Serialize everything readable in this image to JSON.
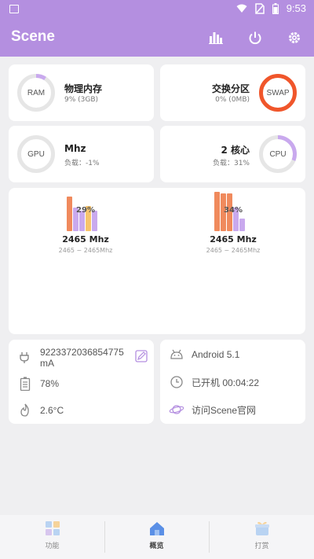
{
  "status": {
    "time": "9:53"
  },
  "app": {
    "title": "Scene"
  },
  "ram": {
    "ring_label": "RAM",
    "title": "物理内存",
    "sub": "9% (3GB)",
    "used_fraction": 0.09
  },
  "swap": {
    "ring_label": "SWAP",
    "title": "交换分区",
    "sub": "0% (0MB)",
    "ring_color": "#f0562b"
  },
  "gpu": {
    "ring_label": "GPU",
    "title": "Mhz",
    "sub": "负载：-1%"
  },
  "cpu": {
    "ring_label": "CPU",
    "title": "2 核心",
    "sub": "负载：31%",
    "load_fraction": 0.31
  },
  "clusters": [
    {
      "percent": "29%",
      "freq": "2465 Mhz",
      "range": "2465 ~ 2465Mhz"
    },
    {
      "percent": "34%",
      "freq": "2465 Mhz",
      "range": "2465 ~ 2465Mhz"
    }
  ],
  "battery": {
    "current": "9223372036854775",
    "current_unit": "mA",
    "level": "78%",
    "temp": "2.6°C"
  },
  "system": {
    "android": "Android 5.1",
    "uptime": "已开机  00:04:22",
    "visit": "访问Scene官网"
  },
  "nav": {
    "items": [
      "功能",
      "概览",
      "打赏"
    ]
  },
  "colors": {
    "accent": "#b48fe0",
    "bar_orange": "#f08a5d",
    "bar_purple": "#c9a9ee",
    "bar_yellow": "#f7c46c"
  }
}
